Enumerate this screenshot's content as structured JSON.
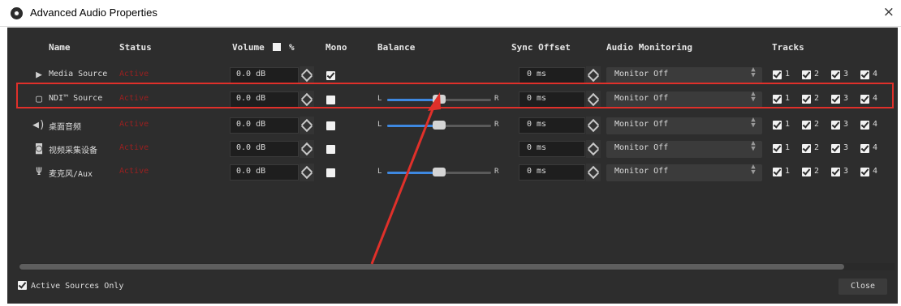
{
  "window": {
    "title": "Advanced Audio Properties",
    "close_glyph": "×"
  },
  "headers": {
    "name": "Name",
    "status": "Status",
    "volume": "Volume",
    "volume_unit": "%",
    "mono": "Mono",
    "balance": "Balance",
    "sync_offset": "Sync Offset",
    "audio_monitoring": "Audio Monitoring",
    "tracks": "Tracks"
  },
  "balance_labels": {
    "left": "L",
    "right": "R"
  },
  "rows": [
    {
      "icon": "play-icon",
      "name": "Media Source",
      "status": "Active",
      "volume": "0.0 dB",
      "mono": true,
      "has_balance": false,
      "balance": 0.5,
      "sync": "0 ms",
      "monitoring": "Monitor Off",
      "tracks": [
        {
          "n": "1",
          "on": true
        },
        {
          "n": "2",
          "on": true
        },
        {
          "n": "3",
          "on": true
        },
        {
          "n": "4",
          "on": true
        }
      ]
    },
    {
      "icon": "file-icon",
      "name": "NDI™ Source",
      "status": "Active",
      "volume": "0.0 dB",
      "mono": false,
      "has_balance": true,
      "balance": 0.5,
      "sync": "0 ms",
      "monitoring": "Monitor Off",
      "tracks": [
        {
          "n": "1",
          "on": true
        },
        {
          "n": "2",
          "on": true
        },
        {
          "n": "3",
          "on": true
        },
        {
          "n": "4",
          "on": true
        }
      ]
    },
    {
      "icon": "speaker-icon",
      "name": "桌面音频",
      "status": "Active",
      "volume": "0.0 dB",
      "mono": false,
      "has_balance": true,
      "balance": 0.5,
      "sync": "0 ms",
      "monitoring": "Monitor Off",
      "tracks": [
        {
          "n": "1",
          "on": true
        },
        {
          "n": "2",
          "on": true
        },
        {
          "n": "3",
          "on": true
        },
        {
          "n": "4",
          "on": true
        }
      ]
    },
    {
      "icon": "camera-icon",
      "name": "视频采集设备",
      "status": "Active",
      "volume": "0.0 dB",
      "mono": false,
      "has_balance": false,
      "balance": 0.5,
      "sync": "0 ms",
      "monitoring": "Monitor Off",
      "tracks": [
        {
          "n": "1",
          "on": true
        },
        {
          "n": "2",
          "on": true
        },
        {
          "n": "3",
          "on": true
        },
        {
          "n": "4",
          "on": true
        }
      ]
    },
    {
      "icon": "microphone-icon",
      "name": "麦克风/Aux",
      "status": "Active",
      "volume": "0.0 dB",
      "mono": false,
      "has_balance": true,
      "balance": 0.5,
      "sync": "0 ms",
      "monitoring": "Monitor Off",
      "tracks": [
        {
          "n": "1",
          "on": true
        },
        {
          "n": "2",
          "on": true
        },
        {
          "n": "3",
          "on": true
        },
        {
          "n": "4",
          "on": true
        }
      ]
    }
  ],
  "footer": {
    "active_sources_only": "Active Sources Only",
    "active_checked": true,
    "close": "Close"
  },
  "colors": {
    "background": "#2d2d2d",
    "status_active": "#9a2020",
    "accent": "#3e88e0",
    "annotation": "#e0302a"
  }
}
